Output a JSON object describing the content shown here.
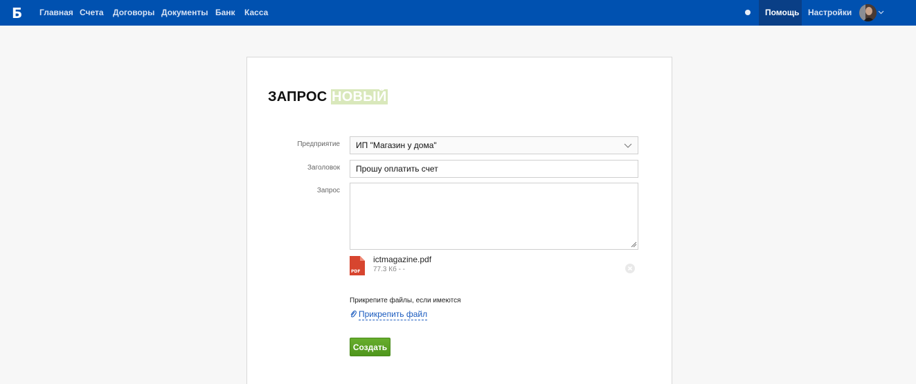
{
  "nav": {
    "logo": "Б",
    "items": [
      "Главная",
      "Счета",
      "Договоры",
      "Документы",
      "Банк",
      "Касса"
    ],
    "help": "Помощь",
    "settings": "Настройки"
  },
  "form": {
    "title": "ЗАПРОС",
    "status": "НОВЫЙ",
    "enterprise_label": "Предприятие",
    "enterprise_value": "ИП \"Магазин у дома\"",
    "subject_label": "Заголовок",
    "subject_value": "Прошу оплатить счет",
    "request_label": "Запрос",
    "request_value": "",
    "attachment": {
      "name": "ictmagazine.pdf",
      "size": "77.3 Кб - -",
      "icon_text": "PDF"
    },
    "attach_hint": "Прикрепите файлы, если имеются",
    "attach_link": "Прикрепить файл",
    "create_button": "Создать"
  },
  "colors": {
    "topbar": "#0051b0",
    "accent_green": "#5aa224",
    "status_bg": "#d9e8bb",
    "link": "#1a5bbf"
  }
}
